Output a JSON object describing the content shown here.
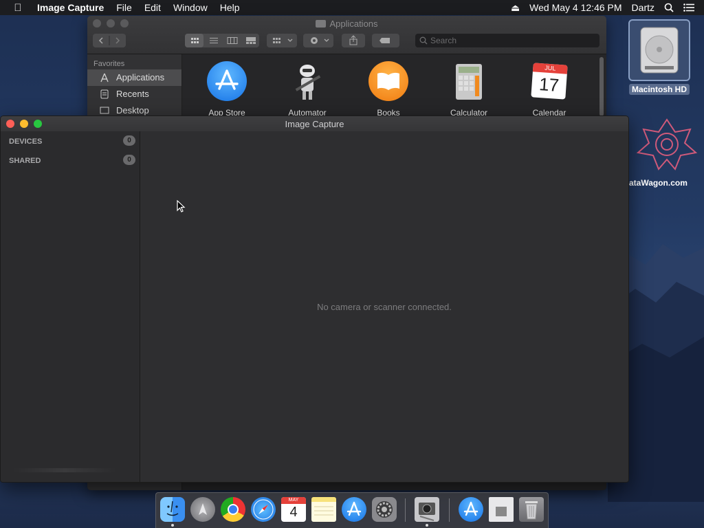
{
  "menubar": {
    "app_name": "Image Capture",
    "menus": [
      "File",
      "Edit",
      "Window",
      "Help"
    ],
    "datetime": "Wed May 4  12:46 PM",
    "user": "Dartz"
  },
  "finder": {
    "title": "Applications",
    "search_placeholder": "Search",
    "sidebar_header": "Favorites",
    "sidebar_items": [
      "Applications",
      "Recents",
      "Desktop"
    ],
    "apps": [
      "App Store",
      "Automator",
      "Books",
      "Calculator",
      "Calendar"
    ],
    "calendar_month": "JUL",
    "calendar_day": "17"
  },
  "image_capture": {
    "title": "Image Capture",
    "sections": [
      {
        "label": "DEVICES",
        "count": "0"
      },
      {
        "label": "SHARED",
        "count": "0"
      }
    ],
    "empty_message": "No camera or scanner connected."
  },
  "desktop": {
    "hd_label": "Macintosh HD",
    "datawagon_label": "ataWagon.com"
  },
  "dock": {
    "calendar_month": "MAY",
    "calendar_day": "4"
  }
}
